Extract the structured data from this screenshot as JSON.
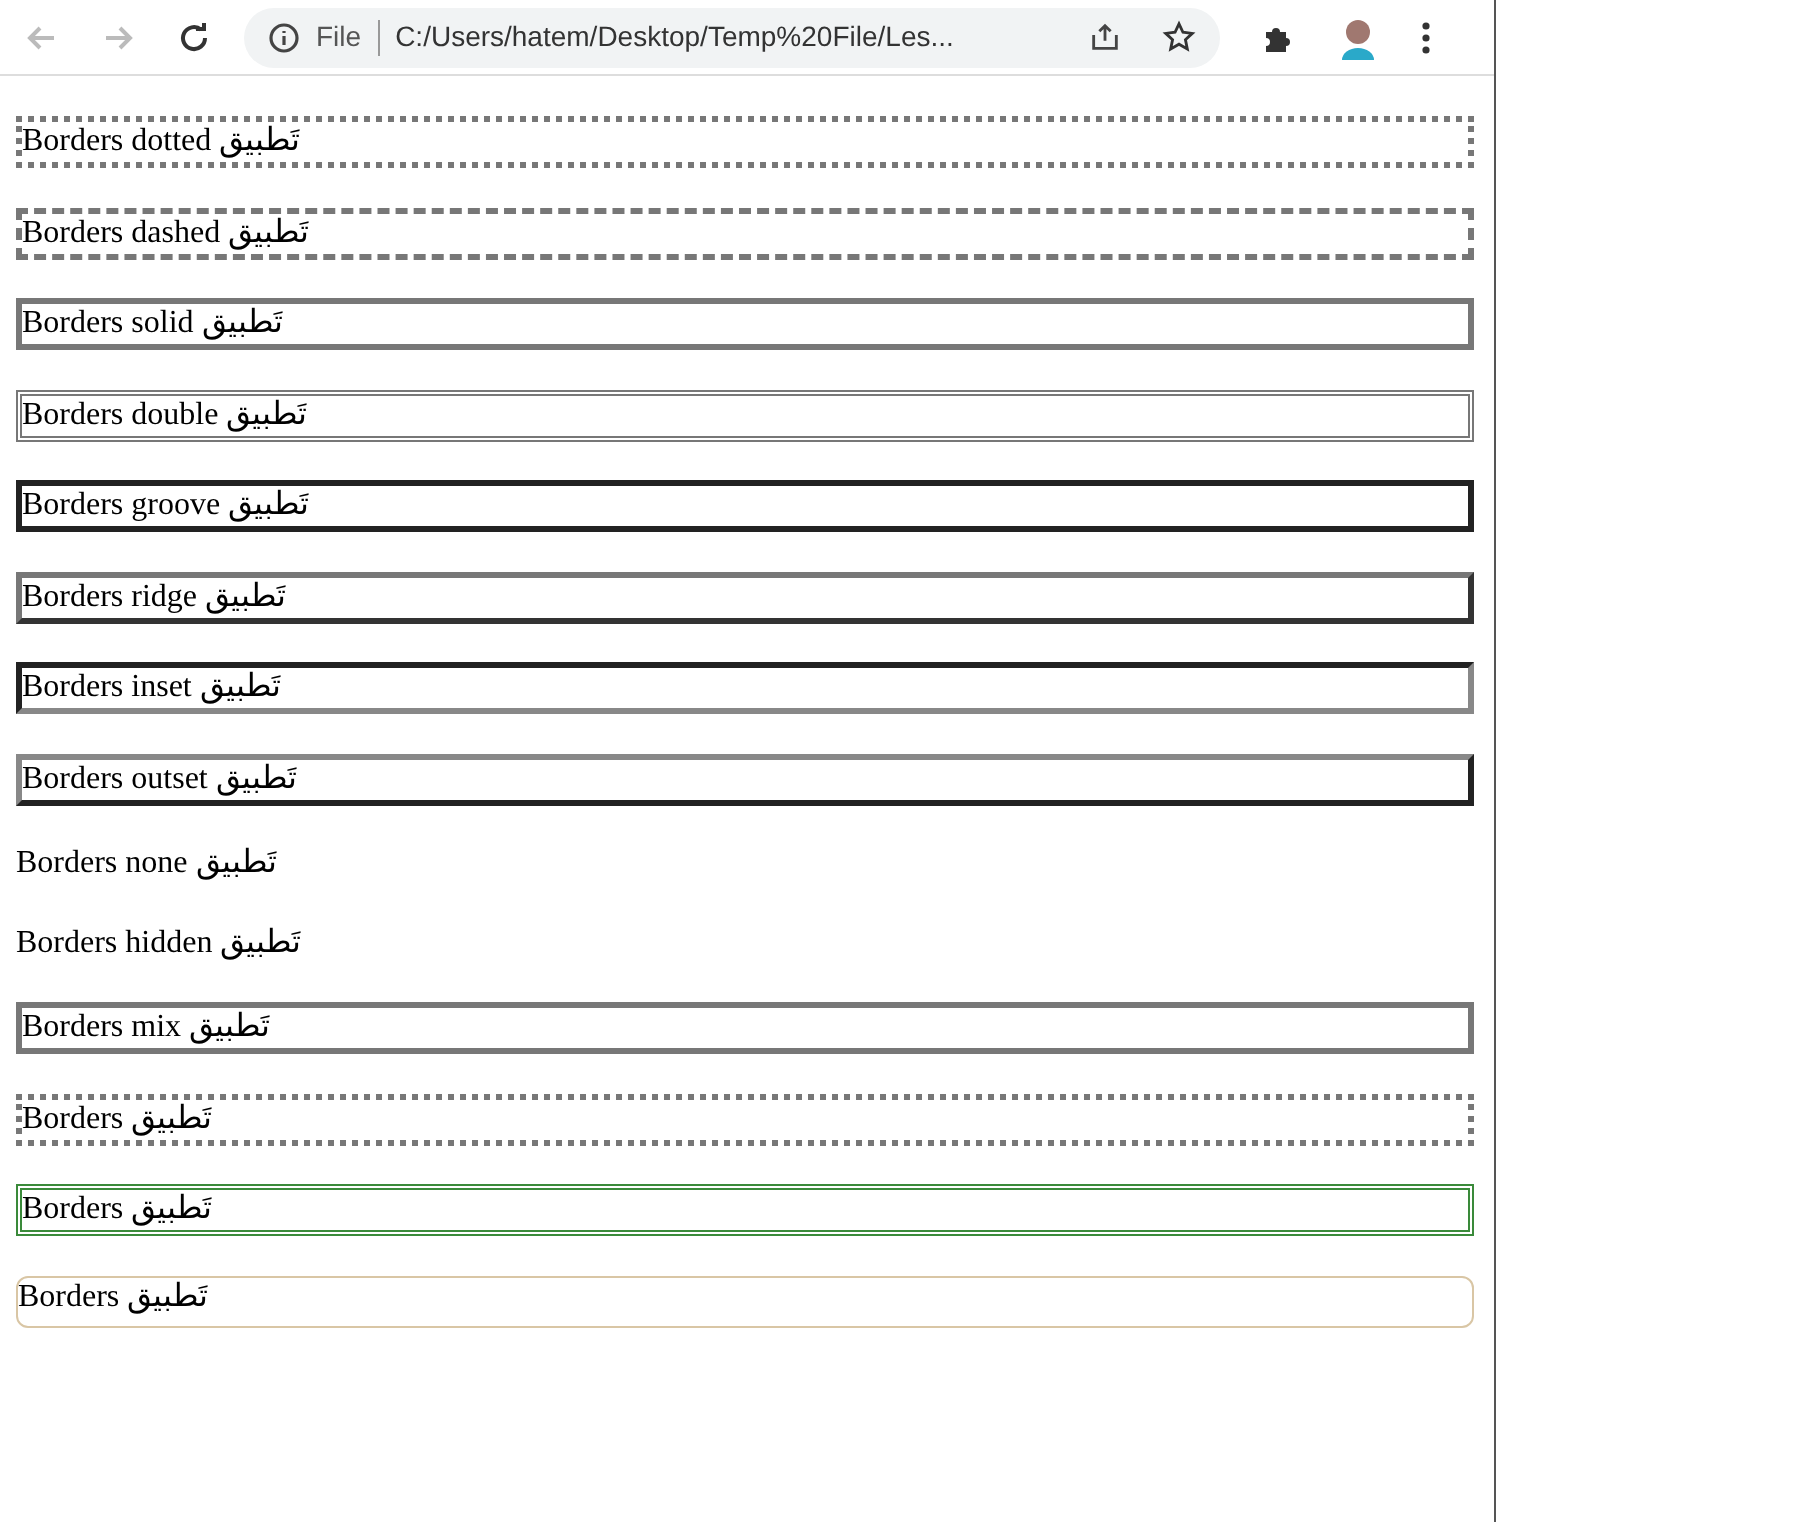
{
  "toolbar": {
    "back_disabled": true,
    "forward_disabled": true,
    "scheme": "File",
    "url": "C:/Users/hatem/Desktop/Temp%20File/Les..."
  },
  "boxes": [
    {
      "text": "Borders dotted تَطبيق",
      "kind": "dotted"
    },
    {
      "text": "Borders dashed تَطبيق",
      "kind": "dashed"
    },
    {
      "text": "Borders solid تَطبيق",
      "kind": "solid"
    },
    {
      "text": "Borders double تَطبيق",
      "kind": "double"
    },
    {
      "text": "Borders groove تَطبيق",
      "kind": "groove"
    },
    {
      "text": "Borders ridge تَطبيق",
      "kind": "ridge"
    },
    {
      "text": "Borders inset تَطبيق",
      "kind": "inset"
    },
    {
      "text": "Borders outset تَطبيق",
      "kind": "outset"
    },
    {
      "text": "Borders none تَطبيق",
      "kind": "none"
    },
    {
      "text": "Borders hidden تَطبيق",
      "kind": "hidden"
    },
    {
      "text": "Borders mix تَطبيق",
      "kind": "mix"
    },
    {
      "text": "Borders تَطبيق",
      "kind": "dotted"
    },
    {
      "text": "Borders تَطبيق",
      "kind": "double-green"
    },
    {
      "text": "Borders تَطبيق",
      "kind": "rounded"
    }
  ]
}
